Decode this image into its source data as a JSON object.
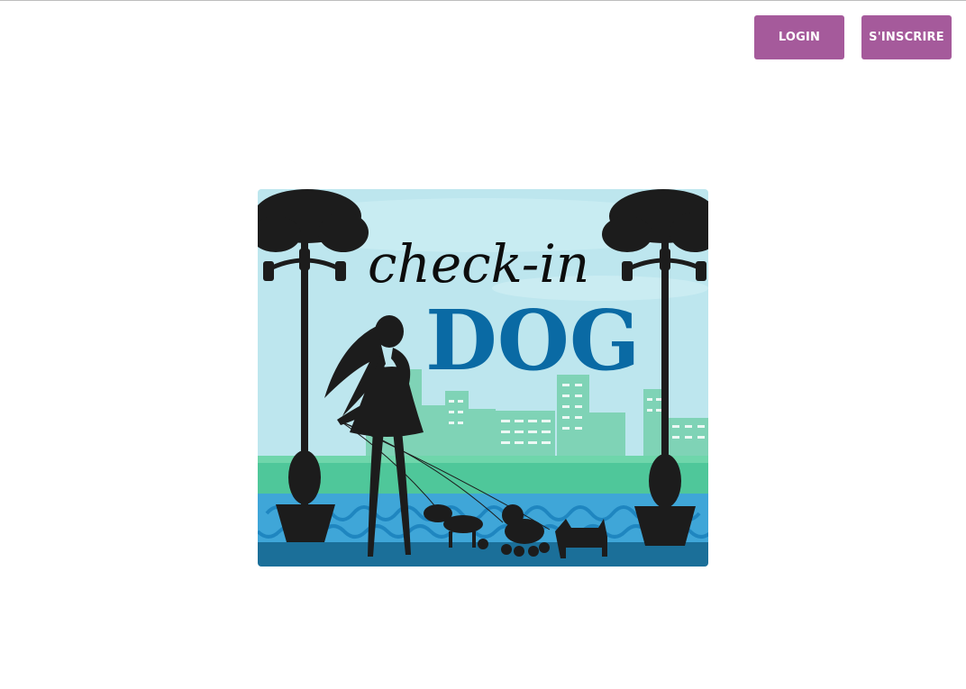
{
  "header": {
    "login_label": "LOGIN",
    "signup_label": "S'INSCRIRE"
  },
  "logo": {
    "line1": "check-in",
    "line2": "DOG"
  },
  "colors": {
    "button_bg": "#a55a9b",
    "sky": "#bde6ee",
    "buildings": "#7fd3b6",
    "grass": "#4fc79a",
    "fence": "#3fa6d8",
    "water": "#1b6f99",
    "dog_text": "#0a6aa4"
  }
}
